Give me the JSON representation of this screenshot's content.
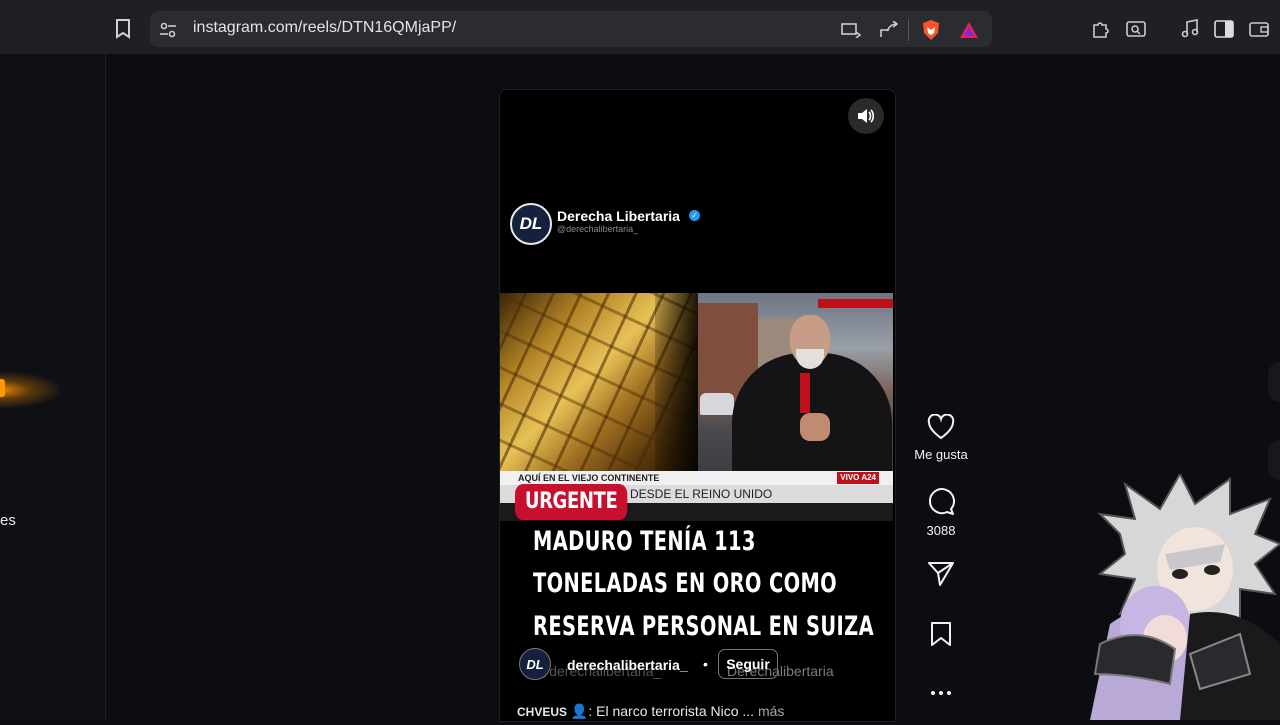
{
  "browser": {
    "url": "instagram.com/reels/DTN16QMjaPP/"
  },
  "left_panel": {
    "partial_text": "es"
  },
  "reel": {
    "channel_name": "Derecha Libertaria",
    "channel_handle": "@derechalibertaria_",
    "logo_text": "DL",
    "news_ticker_top": "AQUÍ EN EL VIEJO CONTINENTE",
    "news_live": "VIVO A24",
    "news_ticker_main": "DESDE EL REINO UNIDO",
    "badge": "URGENTE",
    "headline_lines": [
      "MADURO TENÍA 113",
      "TONELADAS EN ORO COMO",
      "RESERVA PERSONAL EN SUIZA"
    ],
    "ghost_handle": "@derechalibertaria_",
    "ghost_handle2": "Derechalibertaria",
    "username": "derechalibertaria_",
    "separator": "•",
    "follow_label": "Seguir",
    "caption_user": "CHVEUS",
    "caption_text": ": El narco terrorista Nico ...",
    "caption_more": "más"
  },
  "actions": {
    "like_label": "Me gusta",
    "comment_count": "3088"
  }
}
